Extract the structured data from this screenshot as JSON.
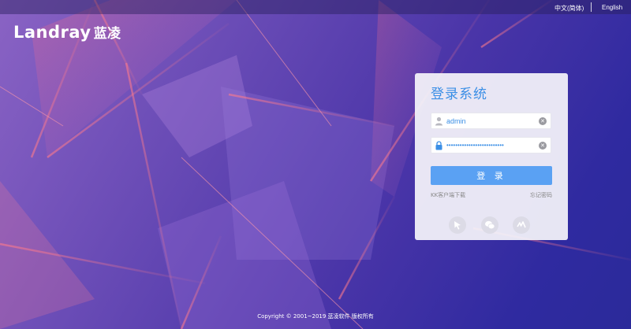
{
  "header": {
    "lang_cn": "中文(简体)",
    "lang_en": "English"
  },
  "logo": {
    "text_en": "Landray",
    "text_cn": "蓝凌"
  },
  "login": {
    "title": "登录系统",
    "username_value": "admin",
    "password_value": "••••••••••••••••••••••••••",
    "submit_label": "登 录",
    "kk_client_link": "KK客户端下载",
    "forgot_link": "忘记密码",
    "social_icons": [
      "cursor-icon",
      "wechat-icon",
      "dingtalk-icon"
    ]
  },
  "footer": {
    "copyright": "Copyright © 2001~2019 蓝凌软件 版权所有"
  },
  "colors": {
    "accent": "#3b8fe6",
    "button": "#5aa1f3",
    "bg_start": "#8a63c4",
    "bg_end": "#2b2a9a"
  }
}
